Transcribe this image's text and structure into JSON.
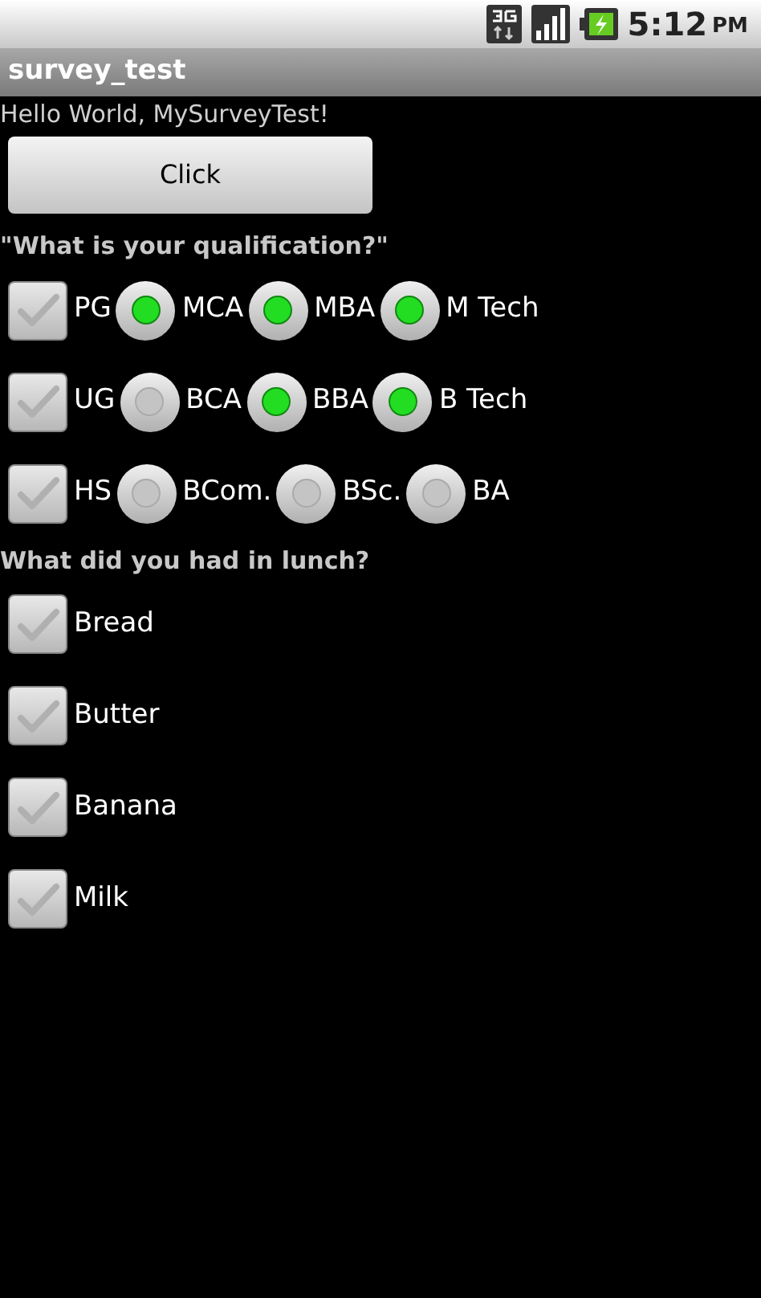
{
  "status_bar": {
    "time": "5:12",
    "period": "PM"
  },
  "title_bar": {
    "title": "survey_test"
  },
  "greeting": "Hello World, MySurveyTest!",
  "button": {
    "label": "Click"
  },
  "question_1": {
    "text": "\"What is your qualification?\"",
    "rows": [
      {
        "label": "PG",
        "checked": false,
        "options": [
          {
            "label": "MCA",
            "selected": true
          },
          {
            "label": "MBA",
            "selected": true
          },
          {
            "label": "M Tech",
            "selected": true
          }
        ]
      },
      {
        "label": "UG",
        "checked": false,
        "options": [
          {
            "label": "BCA",
            "selected": false
          },
          {
            "label": "BBA",
            "selected": true
          },
          {
            "label": "B Tech",
            "selected": true
          }
        ]
      },
      {
        "label": "HS",
        "checked": false,
        "options": [
          {
            "label": "BCom.",
            "selected": false
          },
          {
            "label": "BSc.",
            "selected": false
          },
          {
            "label": "BA",
            "selected": false
          }
        ]
      }
    ]
  },
  "question_2": {
    "text": "What did you had in lunch?",
    "items": [
      {
        "label": "Bread",
        "checked": false
      },
      {
        "label": "Butter",
        "checked": false
      },
      {
        "label": "Banana",
        "checked": false
      },
      {
        "label": "Milk",
        "checked": false
      }
    ]
  }
}
